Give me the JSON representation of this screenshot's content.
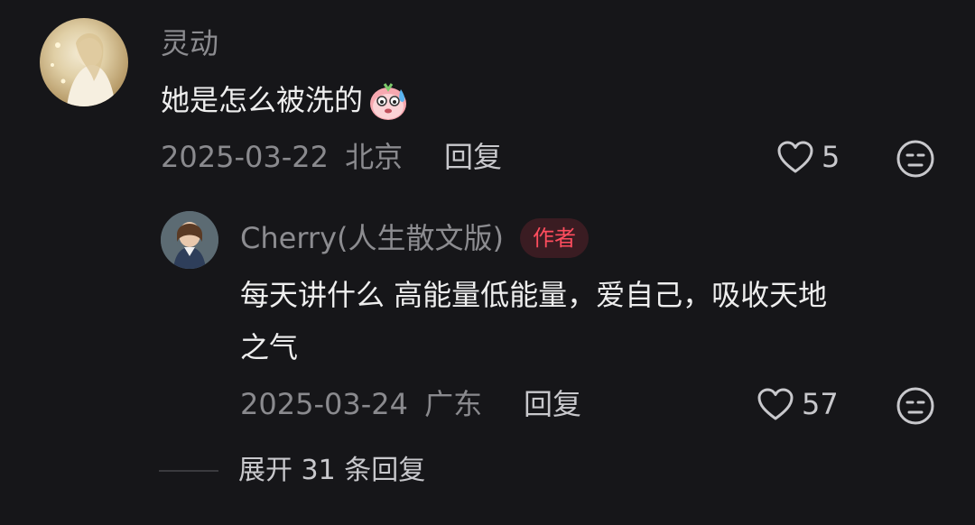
{
  "comment": {
    "author": "灵动",
    "text": "她是怎么被洗的",
    "emoji": "sweat-face-emoji",
    "date": "2025-03-22",
    "location": "北京",
    "reply_label": "回复",
    "likes": "5"
  },
  "reply": {
    "author": "Cherry(人生散文版)",
    "badge": "作者",
    "text_line1": "每天讲什么 高能量低能量，爱自己，吸收天地",
    "text_line2": "之气",
    "date": "2025-03-24",
    "location": "广东",
    "reply_label": "回复",
    "likes": "57"
  },
  "expand_label": "展开 31 条回复",
  "colors": {
    "background": "#161619",
    "badge_text": "#ff4d5e",
    "badge_bg": "#3a1c22"
  }
}
